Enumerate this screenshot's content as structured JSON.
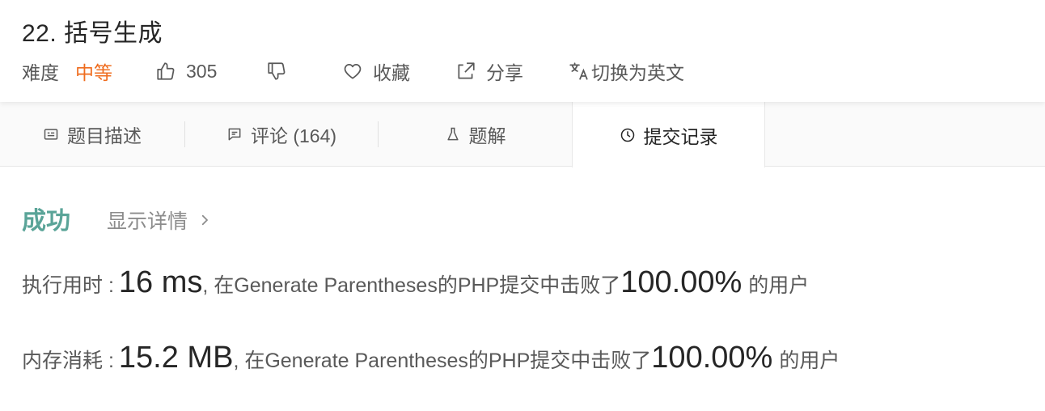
{
  "problem": {
    "title": "22. 括号生成"
  },
  "meta": {
    "difficulty_label": "难度",
    "difficulty_value": "中等",
    "likes": "305",
    "favorite_label": "收藏",
    "share_label": "分享",
    "translate_label": "切换为英文"
  },
  "tabs": [
    {
      "label": "题目描述",
      "icon": "document-icon"
    },
    {
      "label": "评论 (164)",
      "icon": "comment-icon"
    },
    {
      "label": "题解",
      "icon": "flask-icon"
    },
    {
      "label": "提交记录",
      "icon": "clock-icon",
      "active": true
    }
  ],
  "result": {
    "status": "成功",
    "details_link": "显示详情",
    "runtime": {
      "label": "执行用时 :",
      "value": "16 ms",
      "middle": ", 在Generate Parentheses的PHP提交中击败了",
      "percent": "100.00%",
      "suffix": "的用户"
    },
    "memory": {
      "label": "内存消耗 :",
      "value": "15.2 MB",
      "middle": ", 在Generate Parentheses的PHP提交中击败了",
      "percent": "100.00%",
      "suffix": "的用户"
    }
  },
  "colors": {
    "accent_success": "#5aa498",
    "difficulty_medium": "#ef6c1e"
  }
}
